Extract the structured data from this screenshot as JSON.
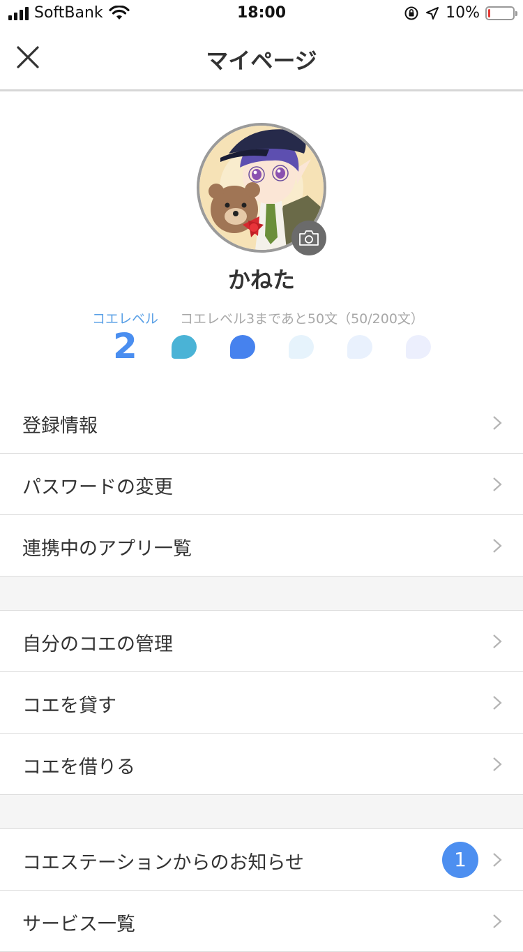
{
  "status_bar": {
    "carrier": "SoftBank",
    "time": "18:00",
    "battery_percent": "10%",
    "battery_level": 0.1,
    "icons": [
      "signal-icon",
      "wifi-icon",
      "rotation-lock-icon",
      "location-icon",
      "battery-icon"
    ]
  },
  "nav": {
    "title": "マイページ",
    "close_icon": "close-icon"
  },
  "profile": {
    "name": "かねた",
    "avatar_icon": "avatar-image",
    "camera_icon": "camera-icon"
  },
  "level": {
    "label": "コエレベル",
    "value": "2",
    "progress_text": "コエレベル3まであと50文（50/200文）",
    "dots": [
      {
        "color": "#4ab3d6",
        "active": true
      },
      {
        "color": "#4682ee",
        "active": true
      },
      {
        "color": "#e6f3fc",
        "active": false
      },
      {
        "color": "#e9f1fd",
        "active": false
      },
      {
        "color": "#eceffd",
        "active": false
      }
    ]
  },
  "menu_groups": [
    [
      {
        "label": "登録情報"
      },
      {
        "label": "パスワードの変更"
      },
      {
        "label": "連携中のアプリ一覧"
      }
    ],
    [
      {
        "label": "自分のコエの管理"
      },
      {
        "label": "コエを貸す"
      },
      {
        "label": "コエを借りる"
      }
    ],
    [
      {
        "label": "コエステーションからのお知らせ",
        "badge": "1"
      },
      {
        "label": "サービス一覧"
      }
    ]
  ],
  "colors": {
    "accent": "#4d8ff0",
    "level_label": "#5aa0e6",
    "section_bg": "#f5f5f5"
  }
}
